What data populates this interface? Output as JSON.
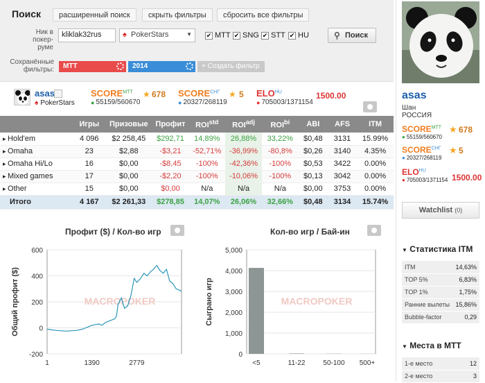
{
  "search": {
    "title": "Поиск",
    "advanced_label": "расширенный поиск",
    "hide_filters_label": "скрыть фильтры",
    "reset_filters_label": "сбросить все фильтры",
    "nick_label_1": "Ник в",
    "nick_label_2": "покер-руме",
    "nick_value": "kliklak32rus",
    "room_value": "PokerStars",
    "checkboxes": [
      "MTT",
      "SNG",
      "STT",
      "HU"
    ],
    "search_button": "Поиск",
    "saved_label_1": "Сохранённые",
    "saved_label_2": "фильтры:",
    "filter_1": "MTT",
    "filter_2": "2014",
    "create_filter": "+ Создать фильтр"
  },
  "player": {
    "name": "asas",
    "room": "PokerStars",
    "score_mtt_label": "SCORE",
    "score_mtt_sup": "MTT",
    "score_mtt_rank": "55159/560670",
    "score_mtt_value": "678",
    "score_sng_label": "SCORE",
    "score_sng_sup": "СНГ",
    "score_sng_rank": "20327/268119",
    "score_sng_value": "5",
    "elo_label": "ELO",
    "elo_sup": "HU",
    "elo_rank": "705003/1371154",
    "elo_value": "1500.00"
  },
  "table": {
    "headers": [
      "",
      "Игры",
      "Призовые",
      "Профит",
      "ROI",
      "ROI",
      "ROI",
      "ABI",
      "AFS",
      "ITM"
    ],
    "roi_sups": [
      "std",
      "adj",
      "bi"
    ],
    "rows": [
      {
        "name": "Hold'em",
        "games": "4 096",
        "prize": "$2 258,45",
        "profit": "$292,71",
        "roi_std": "14,89%",
        "roi_adj": "26,88%",
        "roi_bi": "33,22%",
        "abi": "$0,48",
        "afs": "3131",
        "itm": "15.99%"
      },
      {
        "name": "Omaha",
        "games": "23",
        "prize": "$2,88",
        "profit": "-$3,21",
        "roi_std": "-52,71%",
        "roi_adj": "-36,99%",
        "roi_bi": "-80,8%",
        "abi": "$0,26",
        "afs": "3140",
        "itm": "4.35%"
      },
      {
        "name": "Omaha Hi/Lo",
        "games": "16",
        "prize": "$0,00",
        "profit": "-$8,45",
        "roi_std": "-100%",
        "roi_adj": "-42,36%",
        "roi_bi": "-100%",
        "abi": "$0,53",
        "afs": "3422",
        "itm": "0.00%"
      },
      {
        "name": "Mixed games",
        "games": "17",
        "prize": "$0,00",
        "profit": "-$2,20",
        "roi_std": "-100%",
        "roi_adj": "-10,06%",
        "roi_bi": "-100%",
        "abi": "$0,13",
        "afs": "3042",
        "itm": "0.00%"
      },
      {
        "name": "Other",
        "games": "15",
        "prize": "$0,00",
        "profit": "$0,00",
        "roi_std": "N/a",
        "roi_adj": "N/a",
        "roi_bi": "N/a",
        "abi": "$0,00",
        "afs": "3753",
        "itm": "0.00%"
      }
    ],
    "total": {
      "name": "Итого",
      "games": "4 167",
      "prize": "$2 261,33",
      "profit": "$278,85",
      "roi_std": "14,07%",
      "roi_adj": "26,06%",
      "roi_bi": "32,66%",
      "abi": "$0,48",
      "afs": "3134",
      "itm": "15.74%"
    }
  },
  "chart_data": [
    {
      "type": "line",
      "title": "Профит ($) / Кол-во игр",
      "xlabel": "",
      "ylabel": "Общий профит ($)",
      "xticks": [
        "1",
        "1390",
        "2779"
      ],
      "yticks": [
        "-200",
        "0",
        "200",
        "400",
        "600"
      ],
      "ylim": [
        -200,
        600
      ],
      "xlim": [
        1,
        4167
      ],
      "watermark": "MACROPOKER",
      "x": [
        1,
        300,
        600,
        900,
        1100,
        1200,
        1300,
        1390,
        1500,
        1600,
        1700,
        1800,
        1900,
        2000,
        2100,
        2150,
        2200,
        2300,
        2400,
        2500,
        2600,
        2700,
        2779,
        2900,
        3000,
        3100,
        3200,
        3300,
        3400,
        3500,
        3600,
        3700,
        3800,
        3900,
        4000,
        4100,
        4167
      ],
      "y": [
        -10,
        -20,
        -25,
        -20,
        -10,
        0,
        10,
        20,
        25,
        30,
        20,
        40,
        50,
        60,
        70,
        90,
        180,
        230,
        150,
        170,
        250,
        380,
        350,
        380,
        420,
        400,
        430,
        450,
        480,
        440,
        420,
        450,
        360,
        340,
        300,
        290,
        280
      ]
    },
    {
      "type": "bar",
      "title": "Кол-во игр / Бай-ин",
      "ylabel": "Сыграно игр",
      "categories": [
        "<5",
        "11-22",
        "50-100",
        "500+"
      ],
      "values": [
        4130,
        20,
        10,
        5
      ],
      "yticks": [
        "0",
        "1,000",
        "2,000",
        "3,000",
        "4,000",
        "5,000"
      ],
      "ylim": [
        0,
        5000
      ],
      "watermark": "MACROPOKER"
    }
  ],
  "side": {
    "name": "asas",
    "city": "Шан",
    "country": "РОССИЯ",
    "score_mtt_label": "SCORE",
    "score_mtt_sup": "MTT",
    "score_mtt_rank": "55159/560670",
    "score_mtt_value": "678",
    "score_sng_label": "SCORE",
    "score_sng_sup": "СНГ",
    "score_sng_rank": "20327/268119",
    "score_sng_value": "5",
    "elo_label": "ELO",
    "elo_sup": "HU",
    "elo_rank": "705003/1371154",
    "elo_value": "1500.00",
    "watchlist": "Watchlist",
    "watchlist_count": "(0)",
    "itm_title": "Статистика ITM",
    "itm_rows": [
      {
        "k": "ITM",
        "v": "14,63%"
      },
      {
        "k": "TOP 5%",
        "v": "6,83%"
      },
      {
        "k": "TOP 1%",
        "v": "1,75%"
      },
      {
        "k": "Ранние вылеты",
        "v": "15,86%"
      },
      {
        "k": "Bubble-factor",
        "v": "0,29"
      }
    ],
    "places_title": "Места в MTT",
    "places_rows": [
      {
        "k": "1-е место",
        "v": "12"
      },
      {
        "k": "2-е место",
        "v": "3"
      }
    ]
  },
  "colors": {
    "accent_orange": "#f07d1e",
    "accent_red": "#d33",
    "accent_blue": "#3a8dd8",
    "green": "#3aa241",
    "star": "#f5a623"
  }
}
